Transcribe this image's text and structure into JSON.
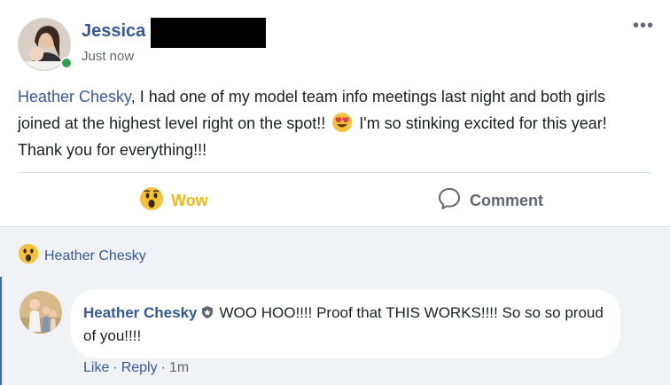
{
  "post": {
    "author_name": "Jessica",
    "timestamp": "Just now",
    "more_label": "•••",
    "mention": "Heather Chesky",
    "text_part1": ", I had one of my model team info meetings last night and both girls joined at the highest level right on the spot!!",
    "emoji_icon": "heart-eyes-emoji",
    "text_part2": " I'm so stinking excited for this year! Thank you for everything!!!",
    "online_status_color": "#31a24c"
  },
  "actions": {
    "wow_label": "Wow",
    "comment_label": "Comment"
  },
  "reactions": {
    "icon": "wow-emoji",
    "name": "Heather Chesky"
  },
  "comments": [
    {
      "author": "Heather Chesky",
      "badge_icon": "shield-badge-icon",
      "text": "WOO HOO!!!! Proof that THIS WORKS!!!! So so so proud of you!!!!",
      "like_label": "Like",
      "reply_label": "Reply",
      "time": "1m"
    }
  ],
  "colors": {
    "link": "#365899",
    "wow": "#f0ba15",
    "muted": "#606770",
    "thread_accent": "#4267b2"
  }
}
